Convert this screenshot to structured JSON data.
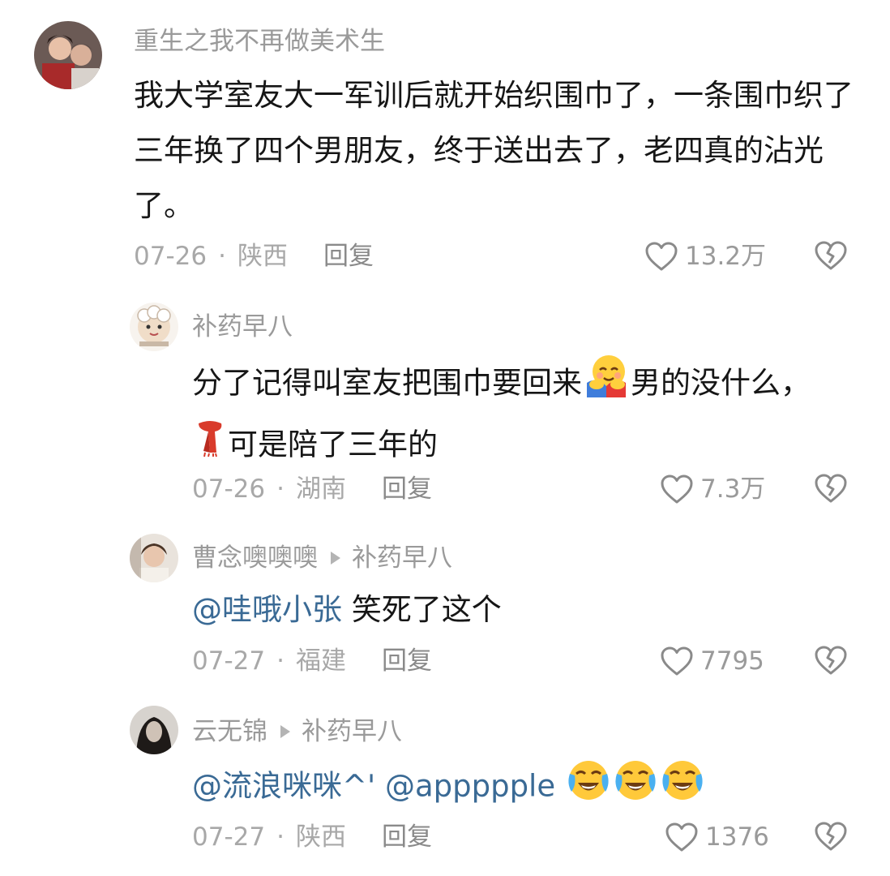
{
  "comments": [
    {
      "username": "重生之我不再做美术生",
      "text": "我大学室友大一军训后就开始织围巾了，一条围巾织了三年换了四个男朋友，终于送出去了，老四真的沾光了。",
      "date": "07-26",
      "location": "陕西",
      "reply_label": "回复",
      "likes": "13.2万"
    },
    {
      "username": "补药早八",
      "text_part1": "分了记得叫室友把围巾要回来",
      "emoji1": "hugging-face",
      "text_part2": "男的没什么，",
      "emoji2": "scarf",
      "text_part3": "可是陪了三年的",
      "date": "07-26",
      "location": "湖南",
      "reply_label": "回复",
      "likes": "7.3万"
    },
    {
      "username": "曹念噢噢噢",
      "reply_to": "补药早八",
      "mention": "@哇哦小张",
      "text": "笑死了这个",
      "date": "07-27",
      "location": "福建",
      "reply_label": "回复",
      "likes": "7795"
    },
    {
      "username": "云无锦",
      "reply_to": "补药早八",
      "mention1": "@流浪咪咪^'",
      "mention2": "@appppple",
      "emojis": [
        "crying-laughing-face",
        "crying-laughing-face",
        "crying-laughing-face"
      ],
      "date": "07-27",
      "location": "陕西",
      "reply_label": "回复",
      "likes": "1376"
    }
  ],
  "separator_dot": "·",
  "colors": {
    "meta": "#a8a8a8",
    "mention": "#3a6a95",
    "text": "#161616"
  }
}
